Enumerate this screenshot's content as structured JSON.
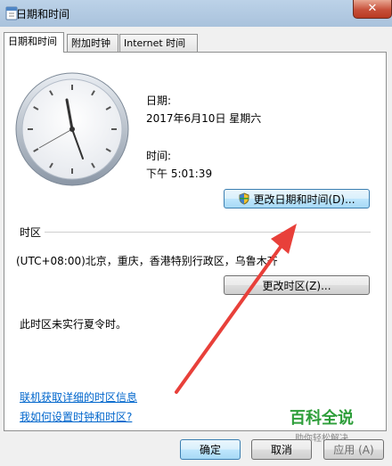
{
  "window": {
    "title": "日期和时间",
    "close_glyph": "✕"
  },
  "tabs": [
    {
      "label": "日期和时间",
      "active": true
    },
    {
      "label": "附加时钟",
      "active": false
    },
    {
      "label": "Internet 时间",
      "active": false
    }
  ],
  "date_section": {
    "date_label": "日期:",
    "date_value": "2017年6月10日 星期六",
    "time_label": "时间:",
    "time_value": "下午 5:01:39"
  },
  "buttons": {
    "change_datetime": "更改日期和时间(D)...",
    "change_timezone": "更改时区(Z)...",
    "ok": "确定",
    "cancel": "取消",
    "apply": "应用 (A)"
  },
  "timezone": {
    "section_label": "时区",
    "value": "(UTC+08:00)北京，重庆，香港特别行政区，乌鲁木齐",
    "dst_note": "此时区未实行夏令时。"
  },
  "links": {
    "more_info": "联机获取详细的时区信息",
    "how_to_set": "我如何设置时钟和时区?"
  },
  "watermark": {
    "main": "百科全说",
    "sub": "助你轻松解决"
  },
  "colors": {
    "arrow": "#e8403a",
    "link": "#0066cc",
    "accent": "#3c7fb1"
  },
  "icons": [
    "datetime-app-icon",
    "close-icon",
    "shield-icon",
    "analog-clock"
  ]
}
